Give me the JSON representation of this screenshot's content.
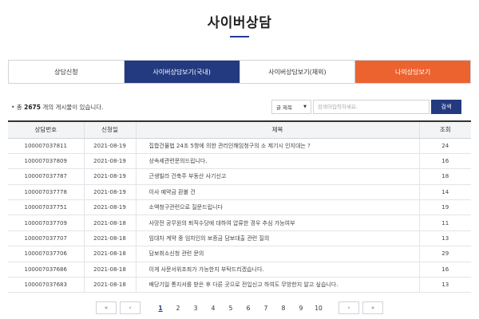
{
  "page_title": "사이버상담",
  "tabs": [
    {
      "label": "상담신청"
    },
    {
      "label": "사이버상담보기(국내)"
    },
    {
      "label": "사이버상담보기(재외)"
    },
    {
      "label": "나의상담보기"
    }
  ],
  "count": {
    "prefix": "• 총",
    "number": "2675",
    "suffix": "개의 게시물이 있습니다."
  },
  "search": {
    "select_value": "글 제목",
    "placeholder": "검색어입력하세요.",
    "button": "검색"
  },
  "table": {
    "headers": [
      "상담번호",
      "신청일",
      "제목",
      "조회"
    ],
    "rows": [
      {
        "no": "100007037811",
        "date": "2021-08-19",
        "subject": "집합건물법 24조 5항에 의한 관리인해임청구의 소 제기시 인지대는 ?",
        "views": "24"
      },
      {
        "no": "100007037809",
        "date": "2021-08-19",
        "subject": "상속세관련문의드립니다.",
        "views": "16"
      },
      {
        "no": "100007037787",
        "date": "2021-08-19",
        "subject": "근생빌라 건축주 부동산 사기신고",
        "views": "18"
      },
      {
        "no": "100007037778",
        "date": "2021-08-19",
        "subject": "이사 예약금 환불 건",
        "views": "14"
      },
      {
        "no": "100007037751",
        "date": "2021-08-19",
        "subject": "소액청구관련으로 질문드립니다",
        "views": "19"
      },
      {
        "no": "100007037709",
        "date": "2021-08-18",
        "subject": "사망전 공무원의 퇴직수당에 대하여 압류한 경우 추심 가능여부",
        "views": "11"
      },
      {
        "no": "100007037707",
        "date": "2021-08-18",
        "subject": "임대차 계약 중 임차인의 보증금 담보대출 관련 질의",
        "views": "13"
      },
      {
        "no": "100007037706",
        "date": "2021-08-18",
        "subject": "담보취소신청 관련 문의",
        "views": "29"
      },
      {
        "no": "100007037686",
        "date": "2021-08-18",
        "subject": "이게 사문서위조죄가 가능한지 부탁드리겠습니다.",
        "views": "16"
      },
      {
        "no": "100007037683",
        "date": "2021-08-18",
        "subject": "배당기일 통지서를 받은 후 다른 곳으로 전입신고 하여도 무방한지 알고 싶습니다.",
        "views": "13"
      }
    ]
  },
  "pager": {
    "first": "«",
    "prev": "‹",
    "pages": [
      "1",
      "2",
      "3",
      "4",
      "5",
      "6",
      "7",
      "8",
      "9",
      "10"
    ],
    "current": "1",
    "next": "›",
    "last": "»"
  },
  "colors": {
    "navy": "#233a80",
    "orange": "#ec6330"
  }
}
